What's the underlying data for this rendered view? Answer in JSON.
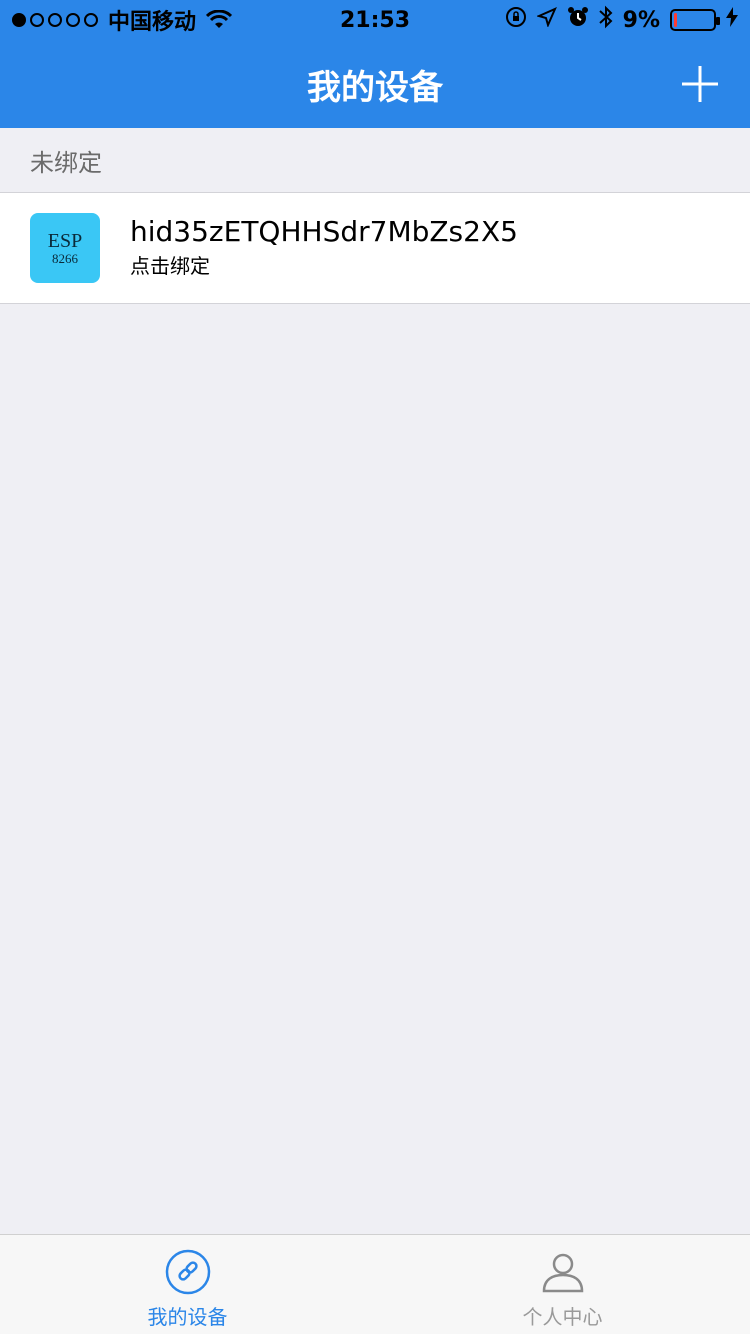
{
  "status_bar": {
    "carrier": "中国移动",
    "time": "21:53",
    "battery_percent": "9%",
    "battery_level": 0.09,
    "icons": [
      "signal-dots",
      "wifi-icon",
      "rotation-lock-icon",
      "location-icon",
      "alarm-icon",
      "bluetooth-icon",
      "battery-icon",
      "charging-icon"
    ]
  },
  "navbar": {
    "title": "我的设备",
    "add_icon": "plus-icon"
  },
  "section": {
    "title": "未绑定"
  },
  "device": {
    "icon_line1": "ESP",
    "icon_line2": "8266",
    "name": "hid35zETQHHSdr7MbZs2X5",
    "subtitle": "点击绑定"
  },
  "tabbar": {
    "tabs": [
      {
        "label": "我的设备",
        "icon": "link-icon",
        "active": true
      },
      {
        "label": "个人中心",
        "icon": "person-icon",
        "active": false
      }
    ]
  },
  "colors": {
    "brand": "#2b86e8",
    "background": "#efeff4",
    "device_icon": "#3ac7f5"
  }
}
